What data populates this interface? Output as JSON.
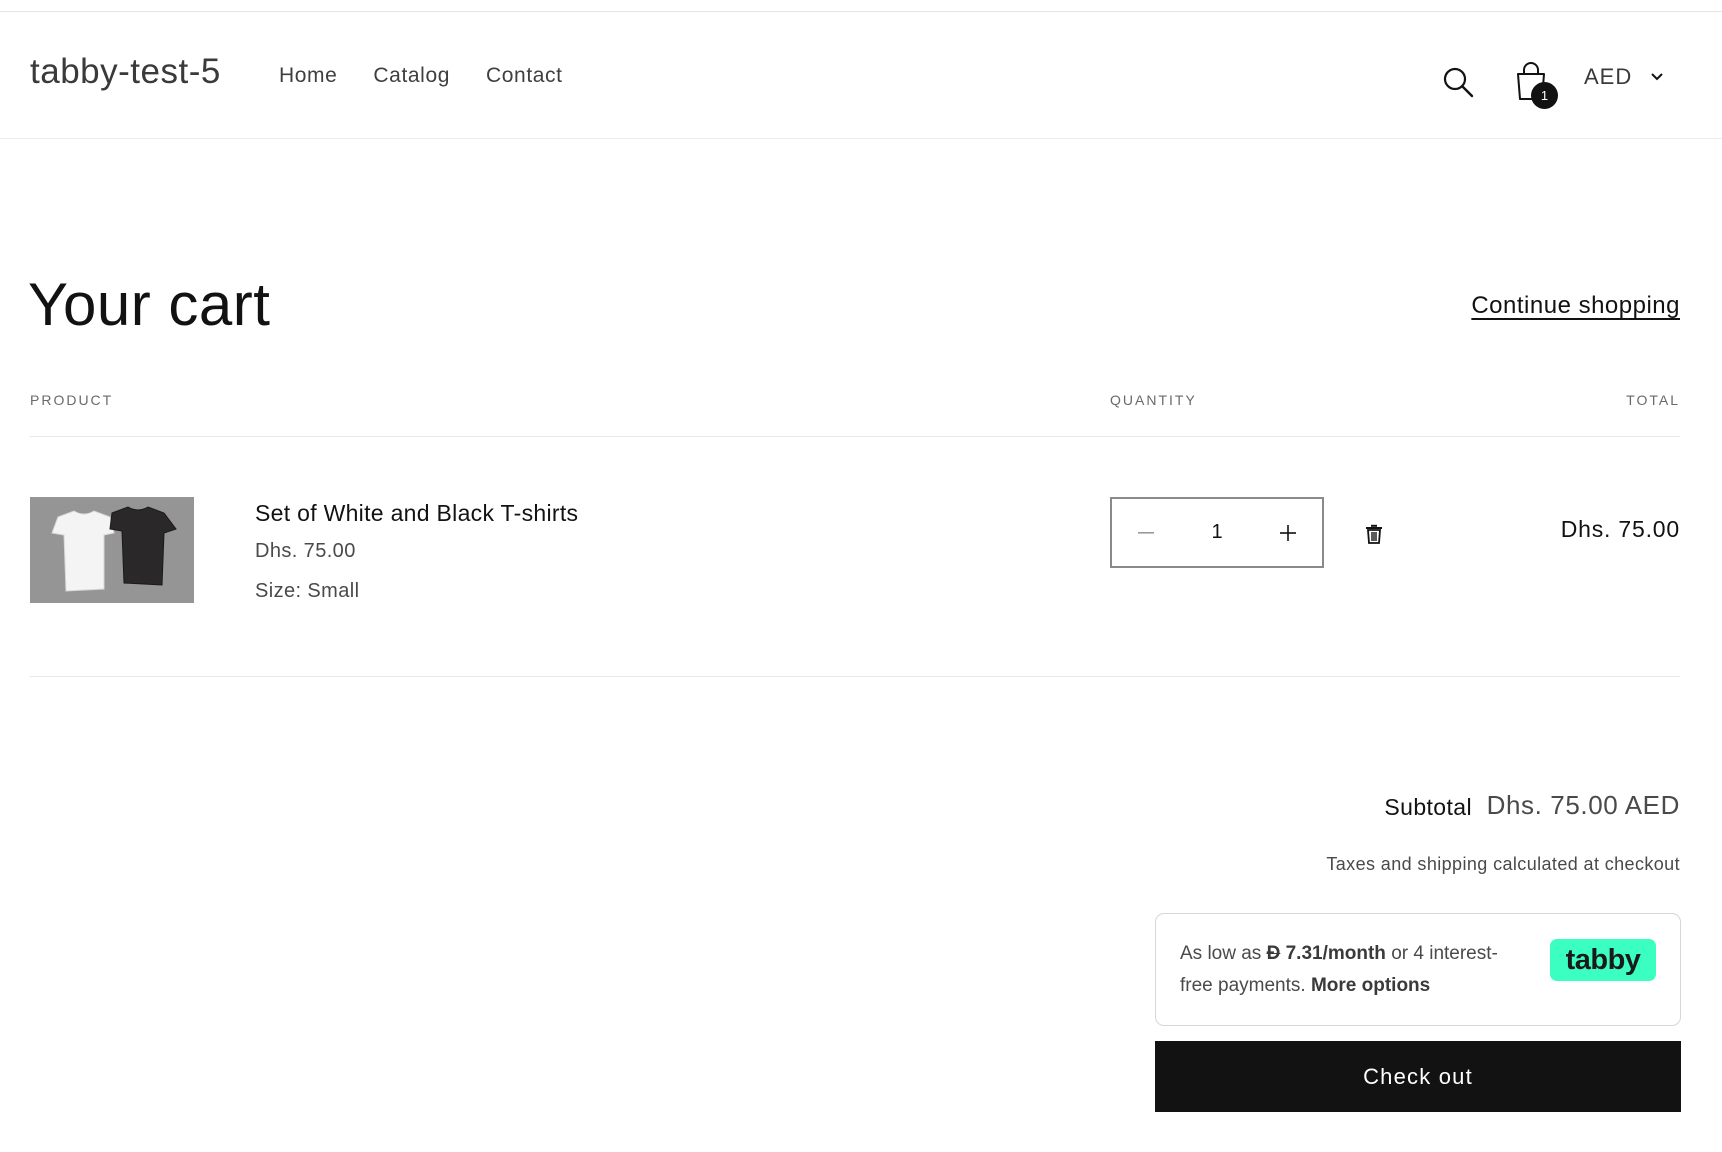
{
  "header": {
    "brand": "tabby-test-5",
    "nav": [
      "Home",
      "Catalog",
      "Contact"
    ],
    "cart_count": "1",
    "currency": "AED"
  },
  "cart": {
    "title": "Your cart",
    "continue_label": "Continue shopping",
    "columns": {
      "product": "PRODUCT",
      "quantity": "QUANTITY",
      "total": "TOTAL"
    },
    "items": [
      {
        "name": "Set of White and Black T-shirts",
        "price": "Dhs. 75.00",
        "size": "Size: Small",
        "quantity": "1",
        "line_total": "Dhs. 75.00",
        "image": "white-and-black-tshirts-photo"
      }
    ]
  },
  "summary": {
    "subtotal_label": "Subtotal",
    "subtotal_value": "Dhs. 75.00 AED",
    "tax_note": "Taxes and shipping calculated at checkout",
    "checkout_label": "Check out"
  },
  "tabby": {
    "prefix": "As low as",
    "currency_symbol": "Ð",
    "amount": "7.31/month",
    "middle": "or 4 interest-free payments.",
    "more": "More options",
    "logo_text": "tabby",
    "logo_color": "#3bffc1"
  },
  "icons": [
    "search-icon",
    "cart-bag-icon",
    "chevron-down-icon",
    "minus-icon",
    "plus-icon",
    "trash-icon"
  ]
}
